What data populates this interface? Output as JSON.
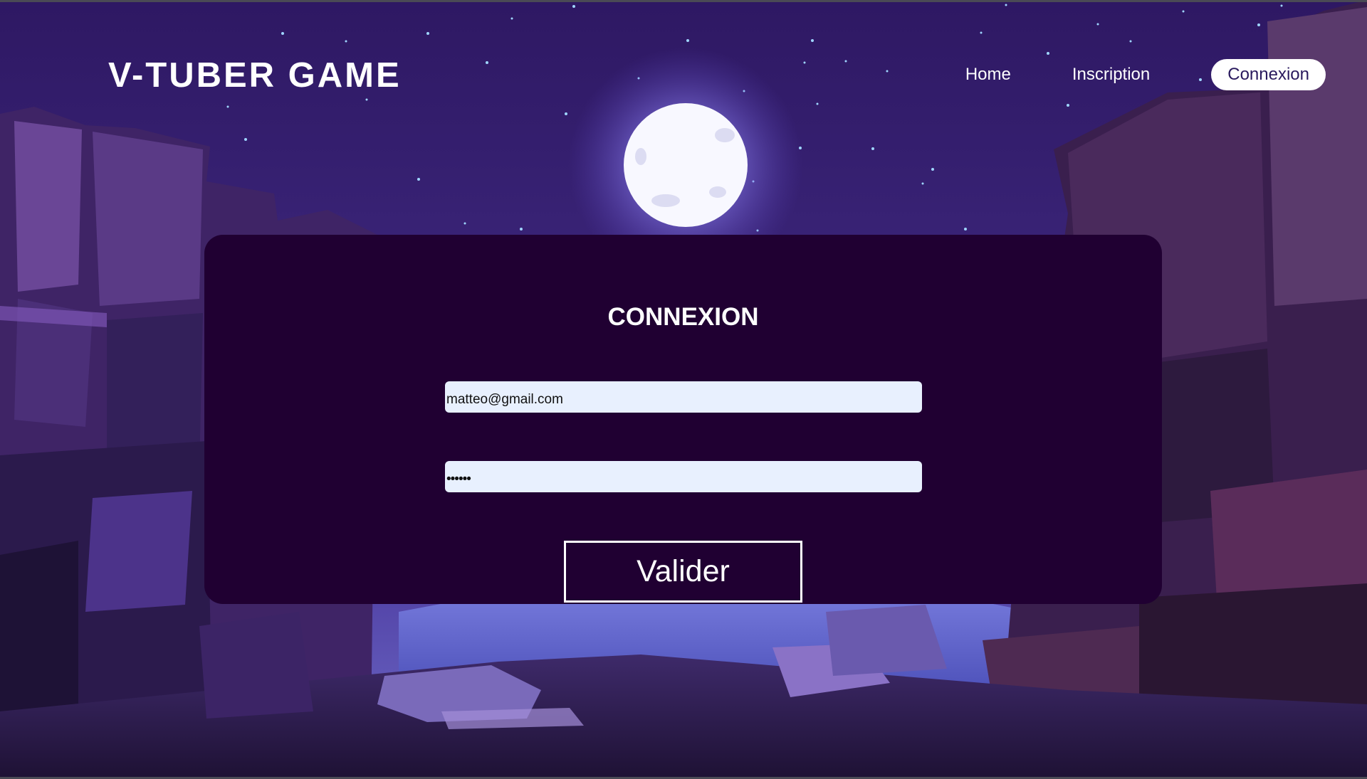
{
  "header": {
    "brand": "V-TUBER GAME",
    "nav": [
      {
        "label": "Home",
        "active": false
      },
      {
        "label": "Inscription",
        "active": false
      },
      {
        "label": "Connexion",
        "active": true
      }
    ]
  },
  "login": {
    "title": "CONNEXION",
    "email_value": "matteo@gmail.com",
    "password_value": "••••••",
    "submit_label": "Valider"
  },
  "colors": {
    "card_background": "#200032",
    "input_background": "#e8f0fe",
    "active_nav_background": "#ffffff",
    "sky_top": "#2e1863",
    "sky_bottom": "#5a4bb0"
  },
  "background": {
    "icon": "moonlit-canyon-illustration"
  }
}
